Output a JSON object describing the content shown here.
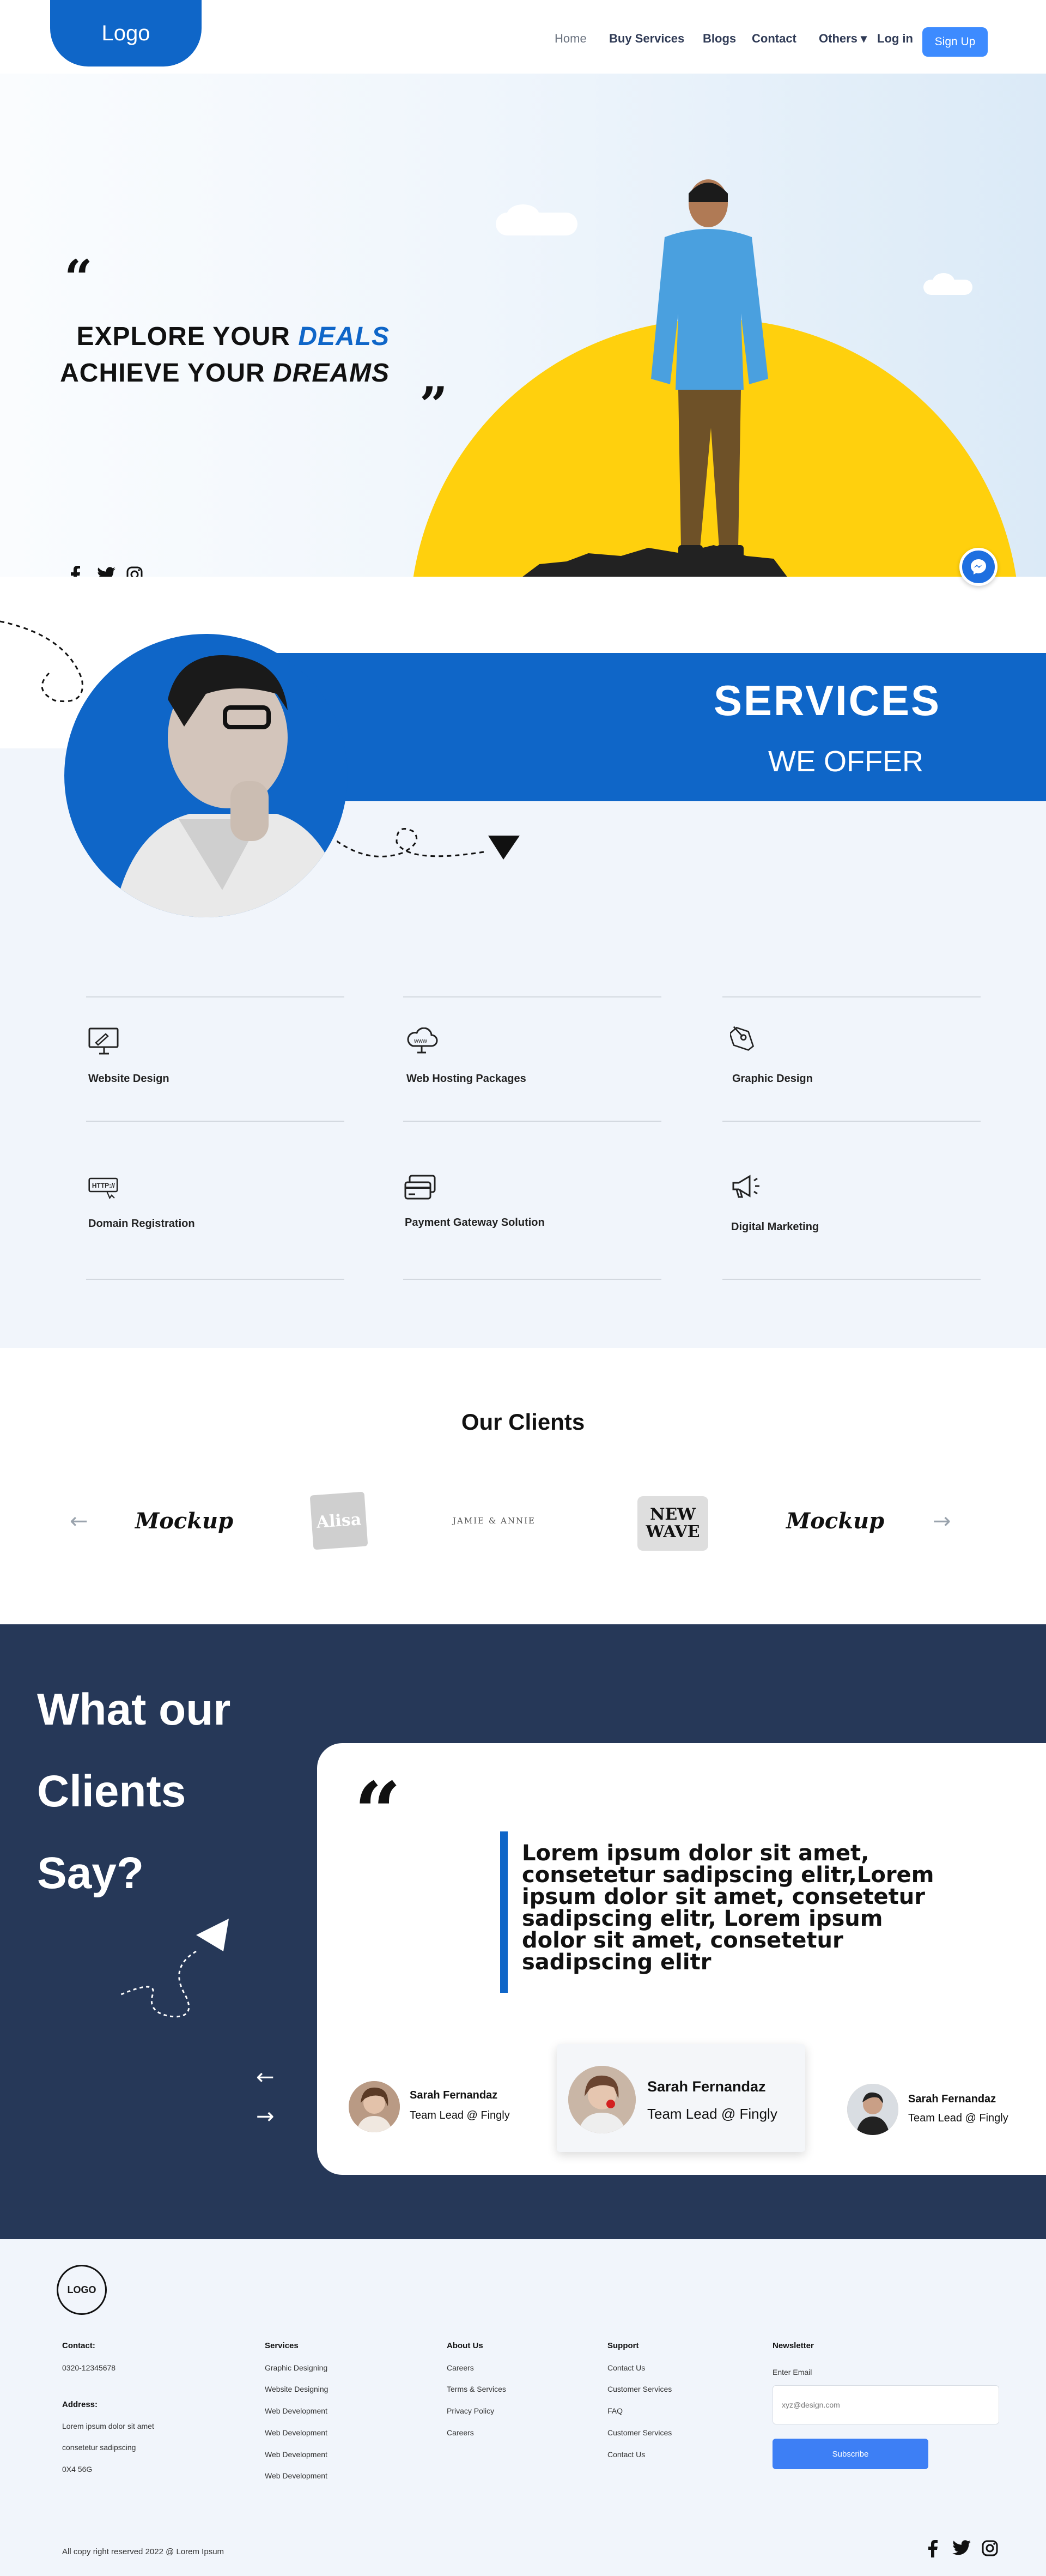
{
  "header": {
    "logo": "Logo",
    "nav": [
      "Home",
      "Buy Services",
      "Blogs",
      "Contact",
      "Others ▾",
      "Log in"
    ],
    "signup": "Sign Up"
  },
  "hero": {
    "line1_a": "EXPLORE YOUR ",
    "line1_b": "DEALS",
    "line2_a": "ACHIEVE YOUR ",
    "line2_b": "DREAMS",
    "quote_open": "“",
    "quote_close": "”"
  },
  "social_icons": [
    "facebook-icon",
    "twitter-icon",
    "instagram-icon"
  ],
  "services": {
    "title": "SERVICES",
    "subtitle": "WE OFFER",
    "items": [
      {
        "label": "Website Design",
        "icon": "monitor-icon"
      },
      {
        "label": "Web Hosting Packages",
        "icon": "cloud-www-icon"
      },
      {
        "label": "Graphic Design",
        "icon": "pen-tool-icon"
      },
      {
        "label": "Domain Registration",
        "icon": "http-icon"
      },
      {
        "label": "Payment Gateway Solution",
        "icon": "credit-card-icon"
      },
      {
        "label": "Digital Marketing",
        "icon": "megaphone-icon"
      }
    ]
  },
  "clients": {
    "title": "Our Clients",
    "logos": [
      "Mockup",
      "Alisa",
      "JAMIE & ANNIE",
      "NEW WAVE",
      "Mockup"
    ]
  },
  "testimonials": {
    "heading": [
      "What our",
      "Clients",
      "Say?"
    ],
    "quote": "Lorem ipsum dolor sit amet, consetetur sadipscing elitr,Lorem ipsum dolor sit amet, consetetur sadipscing elitr, Lorem ipsum dolor sit amet, consetetur sadipscing elitr",
    "people": [
      {
        "name": "Sarah Fernandaz",
        "role": "Team Lead  @ Fingly"
      },
      {
        "name": "Sarah Fernandaz",
        "role": "Team Lead  @ Fingly"
      },
      {
        "name": "Sarah Fernandaz",
        "role": "Team Lead  @ Fingly"
      }
    ]
  },
  "footer": {
    "logo": "LOGO",
    "contact_head": "Contact:",
    "phone": "0320-12345678",
    "address_head": "Address:",
    "address": [
      "Lorem ipsum dolor sit amet",
      "consetetur sadipscing",
      "0X4 56G"
    ],
    "columns": [
      {
        "head": "Services",
        "items": [
          "Graphic Designing",
          "Website Designing",
          "Web Development",
          "Web Development",
          "Web Development",
          "Web Development"
        ]
      },
      {
        "head": "About Us",
        "items": [
          "Careers",
          "Terms & Services",
          "Privacy Policy",
          "Careers"
        ]
      },
      {
        "head": "Support",
        "items": [
          "Contact Us",
          "Customer Services",
          "FAQ",
          "Customer Services",
          "Contact Us"
        ]
      }
    ],
    "newsletter_head": "Newsletter",
    "email_label": "Enter Email",
    "email_placeholder": "xyz@design.com",
    "subscribe": "Subscribe",
    "copyright": "All copy right reserved 2022 @ Lorem Ipsum"
  },
  "colors": {
    "brand_blue": "#0f66c8",
    "sun_yellow": "#ffd00d",
    "navy": "#263858",
    "button_blue": "#3d8bff"
  }
}
